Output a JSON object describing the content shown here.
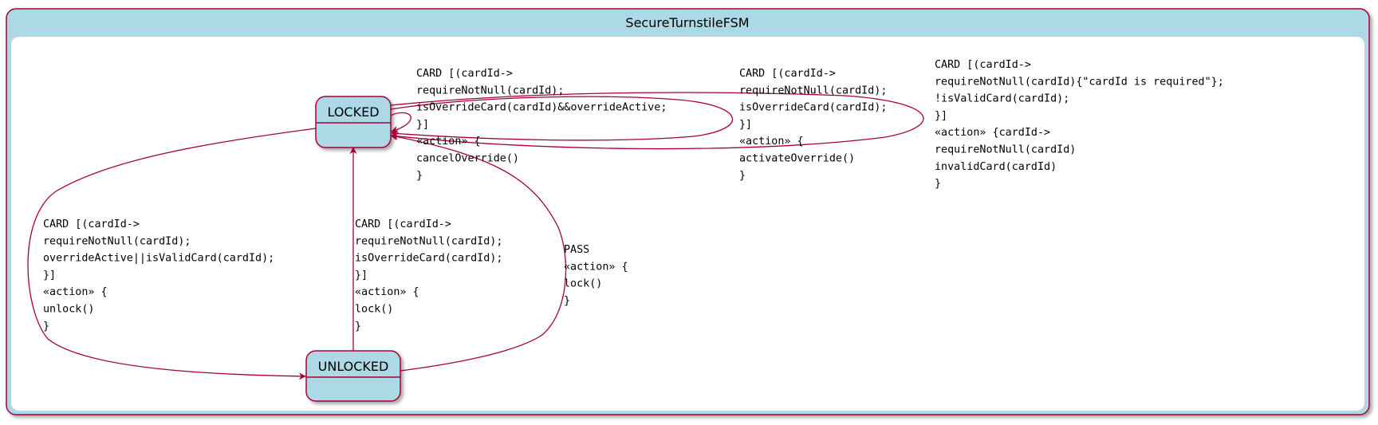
{
  "diagram": {
    "title": "SecureTurnstileFSM",
    "colors": {
      "state_fill": "#add8e6",
      "border": "#a80036",
      "canvas": "#ffffff"
    },
    "states": {
      "locked": "LOCKED",
      "unlocked": "UNLOCKED"
    },
    "transitions": {
      "locked_self_cancel": [
        "CARD [(cardId->",
        "requireNotNull(cardId);",
        "isOverrideCard(cardId)&&overrideActive;",
        "}]",
        "«action» {",
        "cancelOverride()",
        "}"
      ],
      "locked_self_activate": [
        "CARD [(cardId->",
        "requireNotNull(cardId);",
        "isOverrideCard(cardId);",
        "}]",
        "«action» {",
        "activateOverride()",
        "}"
      ],
      "locked_self_invalid": [
        "CARD [(cardId->",
        "requireNotNull(cardId){\"cardId is required\"};",
        "!isValidCard(cardId);",
        "}]",
        "«action» {cardId->",
        "requireNotNull(cardId)",
        "invalidCard(cardId)",
        "}"
      ],
      "locked_to_unlocked": [
        "CARD [(cardId->",
        "requireNotNull(cardId);",
        "overrideActive||isValidCard(cardId);",
        "}]",
        "«action» {",
        "unlock()",
        "}"
      ],
      "unlocked_to_locked_card": [
        "CARD [(cardId->",
        "requireNotNull(cardId);",
        "isOverrideCard(cardId);",
        "}]",
        "«action» {",
        "lock()",
        "}"
      ],
      "unlocked_to_locked_pass": [
        "PASS",
        "«action» {",
        "lock()",
        "}"
      ]
    }
  }
}
